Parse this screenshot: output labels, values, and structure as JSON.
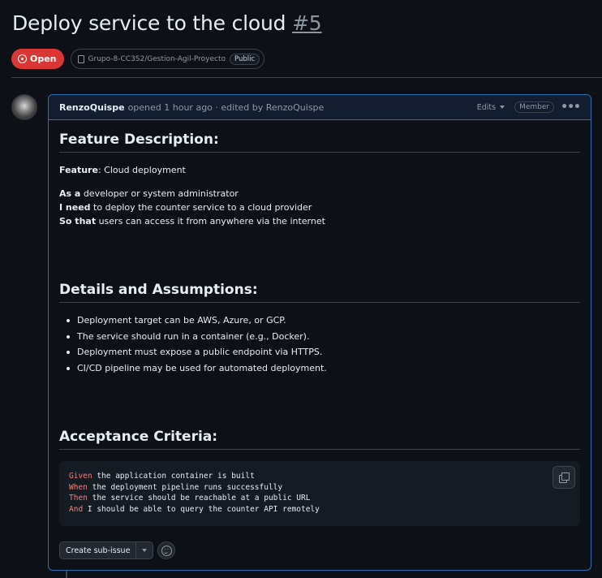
{
  "issue": {
    "title": "Deploy service to the cloud",
    "number": "#5",
    "state": "Open",
    "repo": "Grupo-8-CC3S2/Gestion-Agil-Proyecto",
    "visibility": "Public"
  },
  "comment": {
    "author": "RenzoQuispe",
    "meta": "opened 1 hour ago · edited by RenzoQuispe",
    "edits_label": "Edits",
    "role": "Member",
    "menu_icon": "kebab-horizontal-icon"
  },
  "content": {
    "feature_heading": "Feature Description:",
    "feature_label": "Feature",
    "feature_value": ": Cloud deployment",
    "as_a_label": "As a",
    "as_a_value": " developer or system administrator",
    "i_need_label": "I need",
    "i_need_value": " to deploy the counter service to a cloud provider",
    "so_that_label": "So that",
    "so_that_value": " users can access it from anywhere via the internet",
    "details_heading": "Details and Assumptions:",
    "details_items": [
      "Deployment target can be AWS, Azure, or GCP.",
      "The service should run in a container (e.g., Docker).",
      "Deployment must expose a public endpoint via HTTPS.",
      "CI/CD pipeline may be used for automated deployment."
    ],
    "acceptance_heading": "Acceptance Criteria:",
    "code_lines": [
      {
        "kw": "Given",
        "text": " the application container is built"
      },
      {
        "kw": "When",
        "text": " the deployment pipeline runs successfully"
      },
      {
        "kw": "Then",
        "text": " the service should be reachable at a public URL"
      },
      {
        "kw": "And",
        "text": " I should be able to query the counter API remotely"
      }
    ]
  },
  "actions": {
    "create_sub_issue": "Create sub-issue"
  },
  "colors": {
    "background": "#0d1117",
    "open_badge": "#da3633",
    "comment_border": "#2f6fb0",
    "code_keyword": "#ff7b72"
  }
}
